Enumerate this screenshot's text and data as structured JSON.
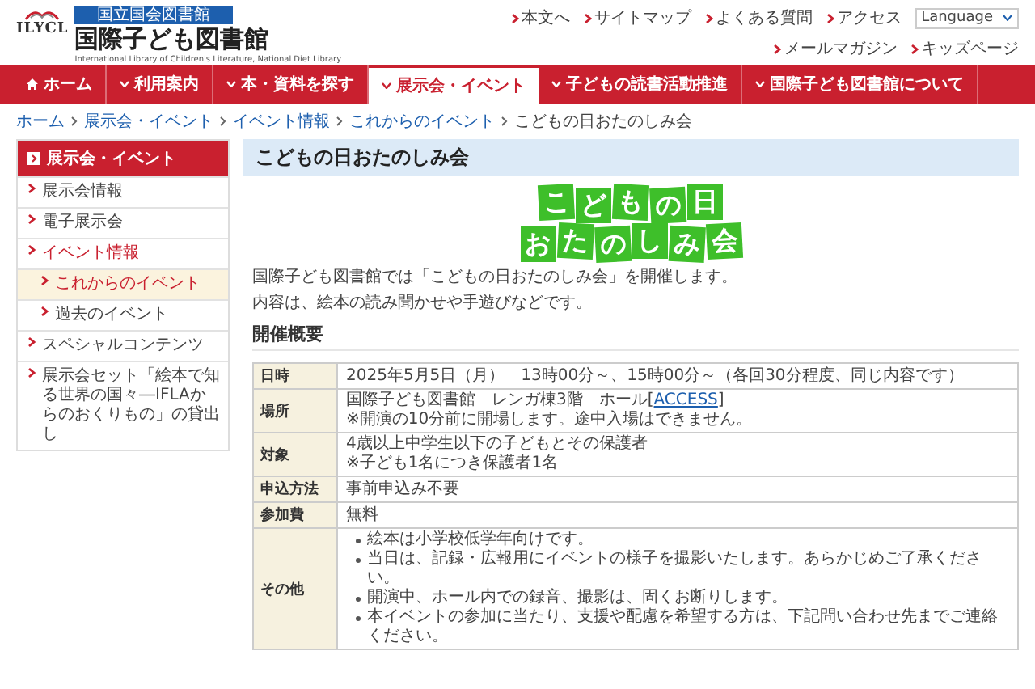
{
  "header": {
    "org_label": "国立国会図書館",
    "logo_text": "ILYCL",
    "title": "国際子ども図書館",
    "subtitle": "International Library of Children's Literature, National Diet Library",
    "links": [
      "本文へ",
      "サイトマップ",
      "よくある質問",
      "アクセス"
    ],
    "language": "Language",
    "links_row2": [
      "メールマガジン",
      "キッズページ"
    ]
  },
  "nav": [
    {
      "label": "ホーム",
      "kind": "home",
      "selected": false
    },
    {
      "label": "利用案内",
      "kind": "menu",
      "selected": false
    },
    {
      "label": "本・資料を探す",
      "kind": "menu",
      "selected": false
    },
    {
      "label": "展示会・イベント",
      "kind": "menu",
      "selected": true
    },
    {
      "label": "子どもの読書活動推進",
      "kind": "menu",
      "selected": false
    },
    {
      "label": "国際子ども図書館について",
      "kind": "menu",
      "selected": false
    }
  ],
  "breadcrumb": {
    "items": [
      "ホーム",
      "展示会・イベント",
      "イベント情報",
      "これからのイベント"
    ],
    "current": "こどもの日おたのしみ会"
  },
  "sidebar": {
    "heading": "展示会・イベント",
    "items": [
      {
        "label": "展示会情報",
        "selected": false
      },
      {
        "label": "電子展示会",
        "selected": false
      },
      {
        "label": "イベント情報",
        "selected": true,
        "children": [
          {
            "label": "これからのイベント",
            "selected": true
          },
          {
            "label": "過去のイベント",
            "selected": false
          }
        ]
      },
      {
        "label": "スペシャルコンテンツ",
        "selected": false
      },
      {
        "label": "展示会セット「絵本で知る世界の国々―IFLAからのおくりもの」の貸出し",
        "selected": false
      }
    ]
  },
  "page_title": "こどもの日おたのしみ会",
  "banner": [
    "こどもの日",
    "おたのしみ会"
  ],
  "paragraphs": [
    "国際子ども図書館では「こどもの日おたのしみ会」を開催します。",
    "内容は、絵本の読み聞かせや手遊びなどです。"
  ],
  "section_heading": "開催概要",
  "table": [
    {
      "label": "日時",
      "kind": "text",
      "lines": [
        {
          "text": "2025年5月5日（月）　13時00分～、15時00分～（各回30分程度、同じ内容です）"
        }
      ]
    },
    {
      "label": "場所",
      "kind": "text",
      "lines": [
        {
          "text": "国際子ども図書館　レンガ棟3階　ホール[",
          "link": "ACCESS",
          "after": "]"
        },
        {
          "text": "※開演の10分前に開場します。途中入場はできません。"
        }
      ]
    },
    {
      "label": "対象",
      "kind": "text",
      "lines": [
        {
          "text": "4歳以上中学生以下の子どもとその保護者"
        },
        {
          "text": "※子ども1名につき保護者1名"
        }
      ]
    },
    {
      "label": "申込方法",
      "kind": "text",
      "lines": [
        {
          "text": "事前申込み不要"
        }
      ]
    },
    {
      "label": "参加費",
      "kind": "text",
      "lines": [
        {
          "text": "無料"
        }
      ]
    },
    {
      "label": "その他",
      "kind": "bullets",
      "lines": [
        {
          "text": "絵本は小学校低学年向けです。"
        },
        {
          "text": "当日は、記録・広報用にイベントの様子を撮影いたします。あらかじめご了承ください。"
        },
        {
          "text": "開演中、ホール内での録音、撮影は、固くお断りします。"
        },
        {
          "text": "本イベントの参加に当たり、支援や配慮を希望する方は、下記問い合わせ先までご連絡ください。"
        }
      ]
    }
  ]
}
